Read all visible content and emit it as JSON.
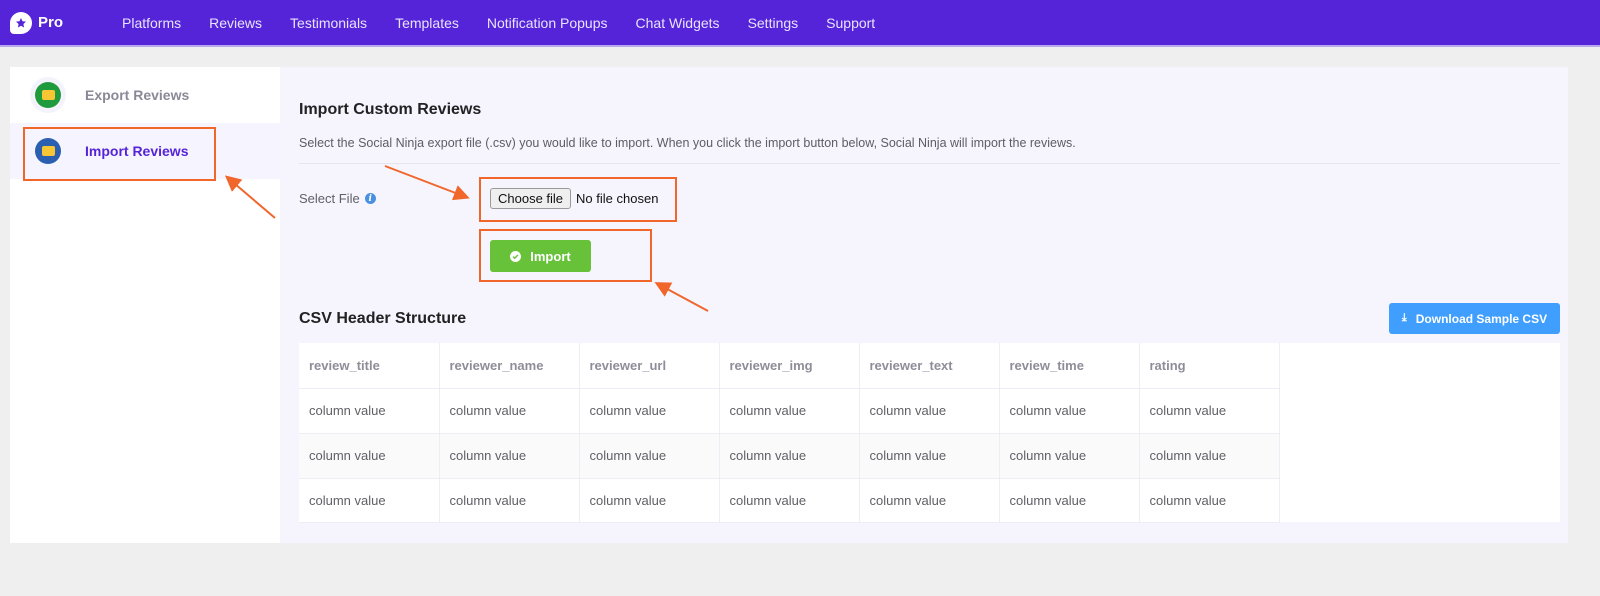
{
  "topbar": {
    "brand": "Pro",
    "nav": [
      "Platforms",
      "Reviews",
      "Testimonials",
      "Templates",
      "Notification Popups",
      "Chat Widgets",
      "Settings",
      "Support"
    ]
  },
  "sidebar": {
    "items": [
      {
        "label": "Export Reviews",
        "icon": "export-icon",
        "active": false
      },
      {
        "label": "Import Reviews",
        "icon": "import-icon",
        "active": true
      }
    ]
  },
  "main": {
    "title": "Import Custom Reviews",
    "description": "Select the Social Ninja export file (.csv) you would like to import. When you click the import button below, Social Ninja will import the reviews.",
    "select_file_label": "Select File",
    "choose_file_label": "Choose file",
    "no_file_text": "No file chosen",
    "import_label": "Import",
    "csv_title": "CSV Header Structure",
    "download_label": "Download Sample CSV",
    "table": {
      "headers": [
        "review_title",
        "reviewer_name",
        "reviewer_url",
        "reviewer_img",
        "reviewer_text",
        "review_time",
        "rating"
      ],
      "rows": [
        [
          "column value",
          "column value",
          "column value",
          "column value",
          "column value",
          "column value",
          "column value"
        ],
        [
          "column value",
          "column value",
          "column value",
          "column value",
          "column value",
          "column value",
          "column value"
        ],
        [
          "column value",
          "column value",
          "column value",
          "column value",
          "column value",
          "column value",
          "column value"
        ]
      ]
    }
  },
  "colors": {
    "brand": "#5524d8",
    "import_button": "#67c23a",
    "download_button": "#409eff",
    "annotation": "#f0662b"
  }
}
